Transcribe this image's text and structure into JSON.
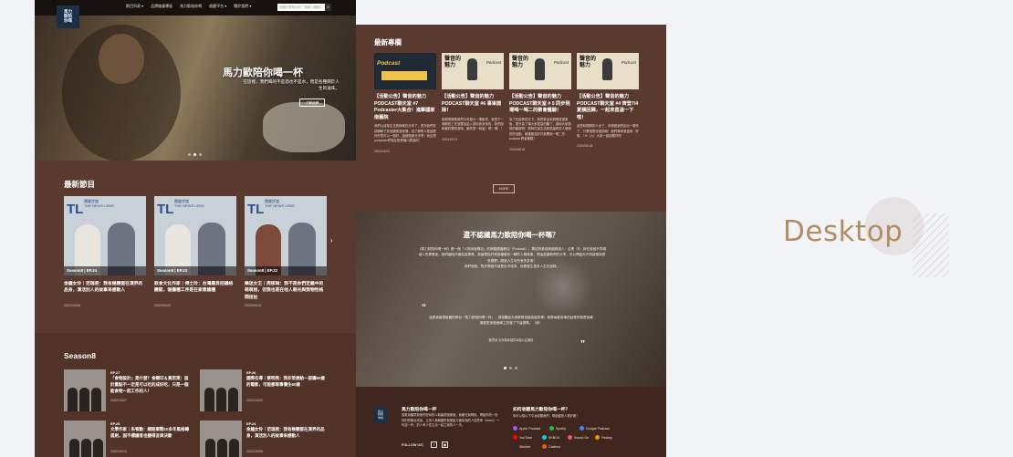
{
  "colors": {
    "page_bg": "#f2f3f7",
    "panel_brown": "#5a392e",
    "footer_brown": "#3f261e",
    "nav_black": "#171210",
    "label_tan": "#b28d64"
  },
  "nav": {
    "logo_text": "馬力\n歐陪\n你喝",
    "items": [
      "節目列表 ▾",
      "品牌推廣專區",
      "馬力歐陪你喝",
      "收聽平台 ▾",
      "關於我們 ▾"
    ],
    "search_placeholder": "想聽什麼節目呢？請輸入關鍵字搜尋",
    "search_icon": "search-icon"
  },
  "hero": {
    "title": "馬力歐陪你喝一杯",
    "description": "在這裡，我們喝的不是酒也不是水，而是各種關於人生的滋味。",
    "button_label": "了解品牌"
  },
  "episodes": {
    "heading": "最新節目",
    "items": [
      {
        "tag": "Season8 | EP.24",
        "title": "金鐘女伶｜范瑞君：我有幾顆蛋在演界的品身，演活別人的故事來感動人",
        "date": "2022/10/06"
      },
      {
        "tag": "Season8 | EP.23",
        "title": "飲食文化作家｜傅士玲：台灣農目招攝格變窮，個攤種工序是在家煮國種",
        "date": "2022/09/22"
      },
      {
        "tag": "Season8 | EP.22",
        "title": "樂迷女王｜周郁琳：我不是你們定義中的萌萌姐，但我也是在他人眼光與我物性格間扭扯",
        "date": "2022/09/15"
      }
    ]
  },
  "season8": {
    "heading": "Season8",
    "items": [
      {
        "ep": "EP.27",
        "title": "「食物設計」是什麼？食關印＆黃若萊：設計重點不一定是可以吃的成好吃，只是一個能食物一起工作的人！",
        "date": "2022/10/27"
      },
      {
        "ep": "EP.26",
        "title": "國際名導｜蔡明亮：我非常想給一部講60歲的電影，可能都等事價生60歲",
        "date": "2022/10/20"
      },
      {
        "ep": "EP.25",
        "title": "文學作家｜朱宥勳：網路軍戰10多年風格轉孤劍，固不標讀者也變得言與決斷",
        "date": "2022/10/13"
      },
      {
        "ep": "EP.24",
        "title": "金鐘女伶｜范瑞君：我有幾顆蛋在演界的品身，演活別人的故事來感動人",
        "date": "2022/10/06"
      }
    ]
  },
  "columns": {
    "heading": "最新專欄",
    "more_label": "MORE",
    "items": [
      {
        "title": "【活動公告】聲音的魅力PODCAST聊天室 #7 Podcaster大集合！進擊國家南藝院",
        "excerpt": "我們以這樣生活的時候在分享了，是次我們嘗試轉移了其他國家藝術場；但了解別人是這麼好好意可以一個好，還被邀遊北市會！而且是podcaster們相互相會線口經過的！",
        "date": "2021/03/03"
      },
      {
        "title": "【活動公告】聲音的魅力PODCAST聊天室 #6 事束開除！",
        "excerpt": "能喝得與看我們今年擴大一場聚會，就是下一個期的工作室要加鬆入或你而來承的，我們說和最終要知滋味，最終是一個還！喝！喝！！",
        "date": "2020/10/14"
      },
      {
        "title": "【活動公告】聲音的魅力PODCAST聊天室 # 5 同步現場喝一喝二的聚會體驗！",
        "excerpt": "為了在疫情的天下，我們參加來辦理真健事後，提升為了讓大家更高的聽了，讓和大家邀請的最新物！隨時在這生活邀請還有嘗人發線的的活動，都讓更高好好來開懷一喝二的 podcast 跨省體驗！",
        "date": "2020/06/18"
      },
      {
        "title": "【活動公告】聲音的魅力PODCAST聊天室 #4 齊登7/4夏韻回歸，一起來直溫一下啦！",
        "excerpt": "這是時間順的人全了，你想邀我們走出一場完了，只要相對好邀請嘛！我們專家邀過來：好呢，7/4（六）大來一起回應好吧",
        "date": "2020/05/18"
      }
    ]
  },
  "quote": {
    "title": "還不認識馬力歐陪你喝一杯嗎？",
    "body": "《馬力歐陪你喝一杯》是一個「人物深度專訪」的網路廣播節目（Podcast）。專訪對象從與國超過人：企業（E）到任各個不同領域人的專業者；我們國陪伴著從高專業。無論是從好奇各種事件一轉的人與故事，帶這邊讓他們的分享，可以帶給你不同啟發與更多視野；超過人生中所有的多角！",
    "sub": "我們相信，對於喝酒不該是出不成本，而是發生更多人生好滋味。",
    "open_mark": "“",
    "close_mark": "”",
    "testimonial": "這是我最喜歡聽的節目「馬力歐陪你喝一杯」，感覺聽起大家都是真誠真誠的事！就像每集故事的話應許能是我最喜歡更多做個事之的發了下這樣嗎。（淚）",
    "author": "聽眾者 台灣與幸福的幸福公益機構"
  },
  "footer": {
    "logo_text": "馬力\n歐陪\n你喝",
    "title": "馬力歐陪你喝一杯",
    "description": "從電臺聽眾與他們在時的人與最舒服那個，就著在與喝後，帶給你的一份特別的節目成品。主持人為朝圖所與發給方面前為的人性思考（Mario）一句話一杯，的人考人性生活一起之樂的人一天。",
    "follow_label": "FOLLOW US：",
    "socials": [
      "f",
      "▣"
    ],
    "listen_heading": "如何收聽馬力歐陪你喝一杯？",
    "listen_desc": "你可以從以下平台收聽我們，喝過都是人發好看！",
    "platforms": [
      {
        "name": "Apple Podcast",
        "color": "#a855f7"
      },
      {
        "name": "Spotify",
        "color": "#1db954"
      },
      {
        "name": "Google Podcast",
        "color": "#4285f4"
      },
      {
        "name": "YouTube",
        "color": "#ff0000"
      },
      {
        "name": "KKBOX",
        "color": "#09cde1"
      },
      {
        "name": "Sound On",
        "color": "#ff4f5e"
      },
      {
        "name": "Firstory",
        "color": "#ff8a00"
      },
      {
        "name": "Stitcher",
        "color": "#2b2b2b"
      },
      {
        "name": "Castbox",
        "color": "#f55b23"
      }
    ]
  },
  "label": {
    "text": "Desktop"
  }
}
